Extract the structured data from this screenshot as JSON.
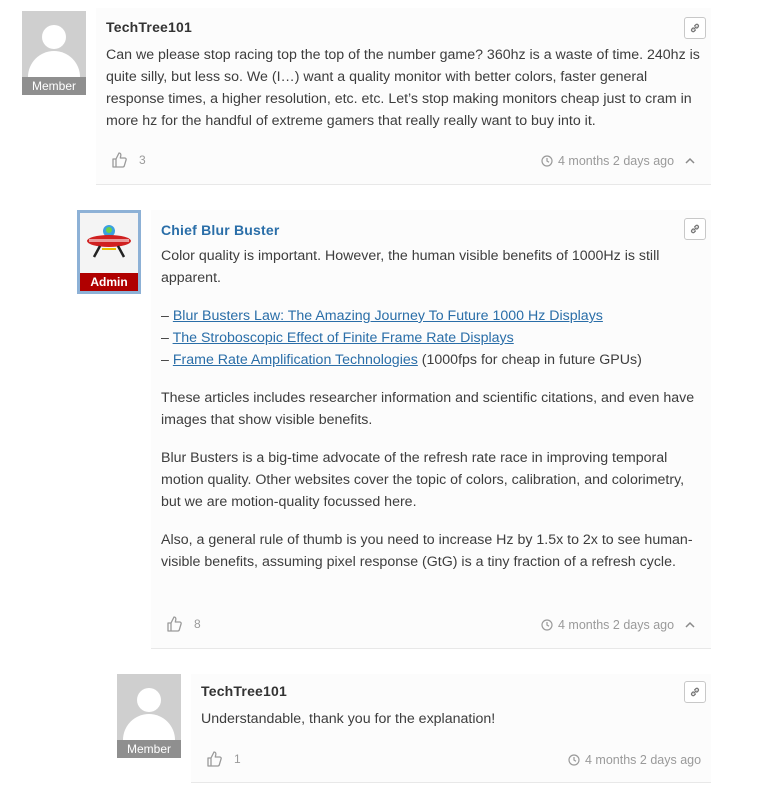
{
  "comments": [
    {
      "author": "TechTree101",
      "role": "Member",
      "text": "Can we please stop racing top the top of the number game? 360hz is a waste of time. 240hz is quite silly, but less so. We (I…) want a quality monitor with better colors, faster general response times, a higher resolution, etc. etc. Let’s stop making monitors cheap just to cram in more hz for the handful of extreme gamers that really really want to buy into it.",
      "votes": "3",
      "time": "4 months 2 days ago"
    },
    {
      "author": "Chief Blur Buster",
      "role": "Admin",
      "paragraph1": "Color quality is important. However, the human visible benefits of 1000Hz is still apparent.",
      "links": [
        {
          "prefix": "– ",
          "label": "Blur Busters Law: The Amazing Journey To Future 1000 Hz Displays",
          "suffix": ""
        },
        {
          "prefix": "– ",
          "label": "The Stroboscopic Effect of Finite Frame Rate Displays",
          "suffix": ""
        },
        {
          "prefix": "– ",
          "label": "Frame Rate Amplification Technologies",
          "suffix": " (1000fps for cheap in future GPUs)"
        }
      ],
      "paragraph2": "These articles includes researcher information and scientific citations, and even have images that show visible benefits.",
      "paragraph3": "Blur Busters is a big-time advocate of the refresh rate race in improving temporal motion quality. Other websites cover the topic of colors, calibration, and colorimetry, but we are motion-quality focussed here.",
      "paragraph4": "Also, a general rule of thumb is you need to increase Hz by 1.5x to 2x to see human-visible benefits, assuming pixel response (GtG) is a tiny fraction of a refresh cycle.",
      "votes": "8",
      "time": "4 months 2 days ago"
    },
    {
      "author": "TechTree101",
      "role": "Member",
      "text": "Understandable, thank you for the explanation!",
      "votes": "1",
      "time": "4 months 2 days ago"
    }
  ],
  "icons": {
    "link": "link-icon",
    "like": "thumbs-up-icon",
    "clock": "clock-icon",
    "collapse": "chevron-up-icon"
  },
  "colors": {
    "admin_name": "#2a6ea8",
    "admin_badge": "#b00000",
    "member_badge": "#8f8f8f",
    "link": "#2a6ea8"
  }
}
